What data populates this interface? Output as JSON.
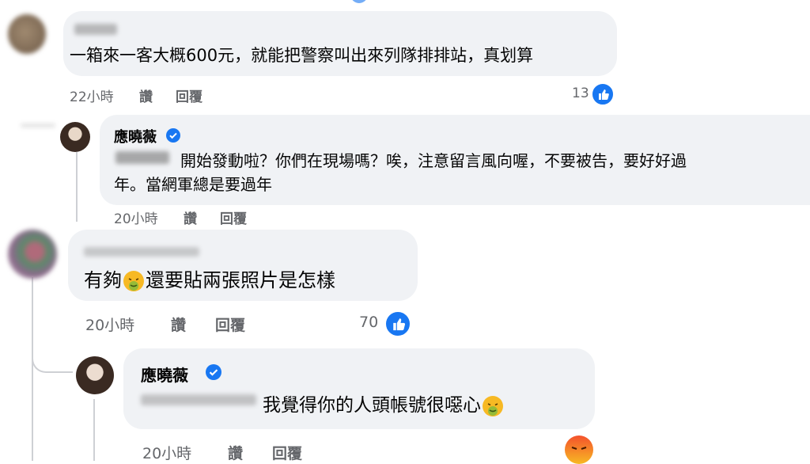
{
  "comments": [
    {
      "author": "",
      "text": "一箱來一客大概600元，就能把警察叫出來列隊排排站，真划算",
      "time": "22小時",
      "like_label": "讚",
      "reply_label": "回覆",
      "reactions": "13"
    },
    {
      "author": "應曉薇",
      "text_line1": "開始發動啦？你們在現場嗎？唉，注意留言風向喔，不要被告，要好好過",
      "text_line2": "年。當網軍總是要過年",
      "time": "20小時",
      "like_label": "讚",
      "reply_label": "回覆"
    },
    {
      "author": "",
      "text_before": "有夠",
      "text_after": "還要貼兩張照片是怎樣",
      "time": "20小時",
      "like_label": "讚",
      "reply_label": "回覆",
      "reactions": "70"
    },
    {
      "author": "應曉薇",
      "text": "我覺得你的人頭帳號很噁心",
      "time": "20小時",
      "like_label": "讚",
      "reply_label": "回覆"
    }
  ],
  "colors": {
    "bubble": "#f0f2f5",
    "like_blue": "#1877f2",
    "meta": "#65676b",
    "angry": "#f4512c"
  },
  "icons": [
    "like-icon",
    "verified-badge-icon",
    "nauseated-emoji-icon",
    "angry-reaction-icon"
  ]
}
